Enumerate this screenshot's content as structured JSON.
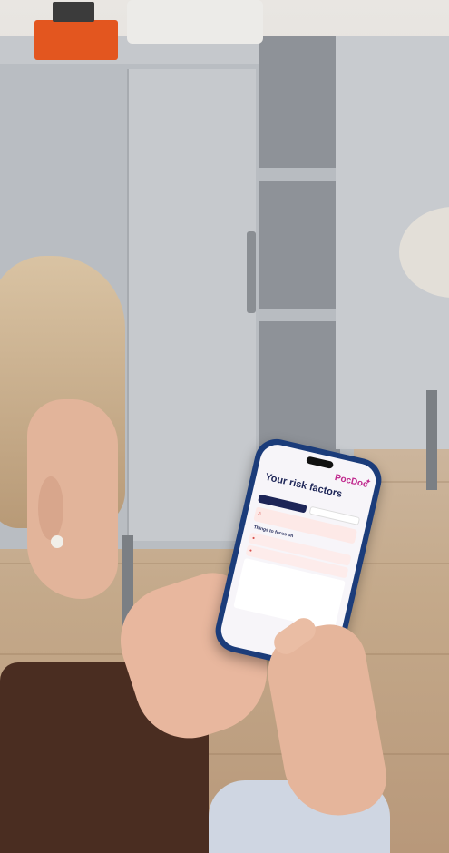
{
  "app": {
    "logo": "PocDoc",
    "title": "Your risk factors",
    "subtitle": ""
  },
  "tabs": [
    "",
    ""
  ],
  "alert": {
    "title": "",
    "text": ""
  },
  "section_title": "Things to focus on",
  "items": [
    "",
    ""
  ],
  "info_text": "",
  "footer": "",
  "colors": {
    "brand": "#c0278d",
    "primary": "#1d2557",
    "alert": "#d9534f",
    "phone_case": "#1b3c7a",
    "vase": "#e3561f"
  },
  "icons": {
    "logo": "sparkle-icon",
    "alert": "warning-icon",
    "item": "alert-circle-icon"
  }
}
